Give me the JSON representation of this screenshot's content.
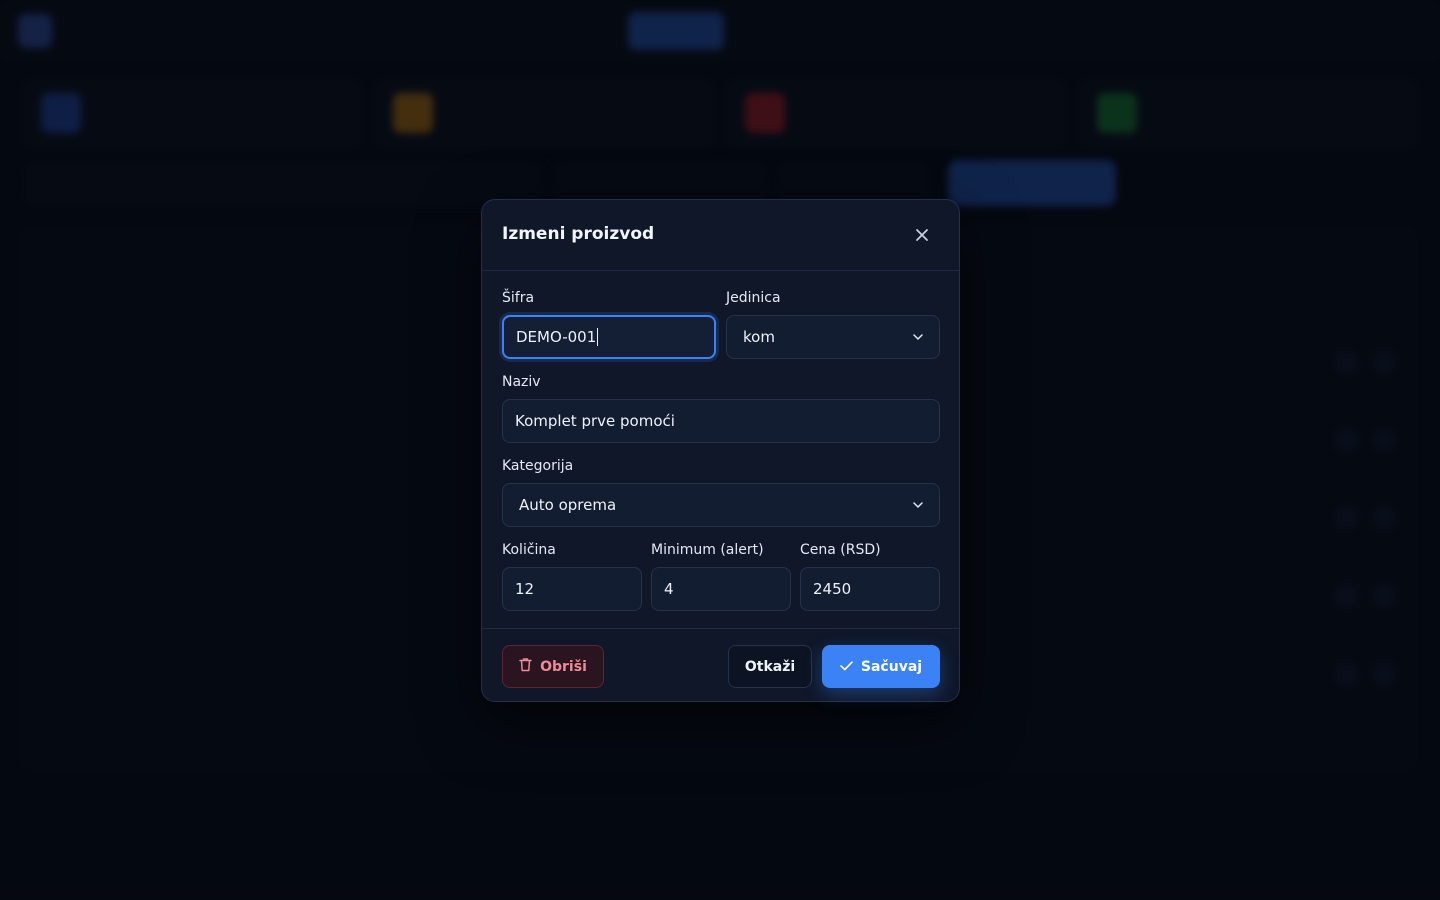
{
  "modal": {
    "title": "Izmeni proizvod",
    "fields": {
      "code": {
        "label": "Šifra",
        "value": "DEMO-001"
      },
      "unit": {
        "label": "Jedinica",
        "value": "kom"
      },
      "name": {
        "label": "Naziv",
        "value": "Komplet prve pomoći"
      },
      "category": {
        "label": "Kategorija",
        "value": "Auto oprema"
      },
      "quantity": {
        "label": "Količina",
        "value": "12"
      },
      "minimum": {
        "label": "Minimum (alert)",
        "value": "4"
      },
      "price": {
        "label": "Cena (RSD)",
        "value": "2450"
      }
    },
    "buttons": {
      "delete": "Obriši",
      "cancel": "Otkaži",
      "save": "Sačuvaj"
    }
  },
  "colors": {
    "accent": "#3b82f6",
    "danger": "#f08a96",
    "modal_bg": "#0f1729",
    "page_bg": "#070b14"
  },
  "icons": {
    "close": "close-icon",
    "trash": "trash-icon",
    "check": "check-icon",
    "chevron": "chevron-down-icon"
  }
}
